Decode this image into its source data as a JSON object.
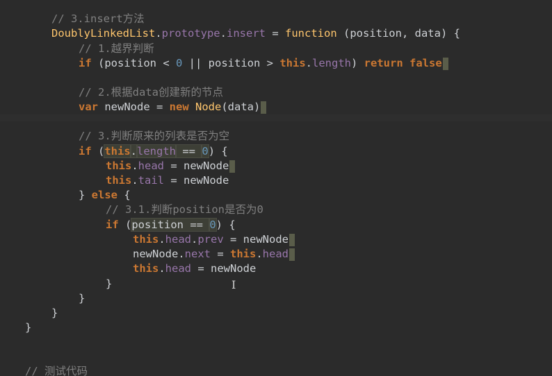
{
  "editor": {
    "lines": [
      {
        "tokens": [
          {
            "t": "// 3.insert方法",
            "c": "comment"
          }
        ]
      },
      {
        "tokens": [
          {
            "t": "DoublyLinkedList",
            "c": "type"
          },
          {
            "t": ".",
            "c": "plain"
          },
          {
            "t": "prototype",
            "c": "prop"
          },
          {
            "t": ".",
            "c": "plain"
          },
          {
            "t": "insert",
            "c": "prop"
          },
          {
            "t": " = ",
            "c": "plain"
          },
          {
            "t": "function",
            "c": "func"
          },
          {
            "t": " (position, data) {",
            "c": "plain"
          }
        ]
      },
      {
        "tokens": [
          {
            "t": "// 1.越界判断",
            "c": "comment"
          }
        ]
      },
      {
        "tokens": [
          {
            "t": "if",
            "c": "keyword"
          },
          {
            "t": " (position < ",
            "c": "plain"
          },
          {
            "t": "0",
            "c": "number"
          },
          {
            "t": " || position > ",
            "c": "plain"
          },
          {
            "t": "this",
            "c": "this"
          },
          {
            "t": ".",
            "c": "plain"
          },
          {
            "t": "length",
            "c": "prop"
          },
          {
            "t": ") ",
            "c": "plain"
          },
          {
            "t": "return",
            "c": "keyword"
          },
          {
            "t": " ",
            "c": "plain"
          },
          {
            "t": "false",
            "c": "keyword"
          }
        ]
      },
      {
        "tokens": []
      },
      {
        "tokens": [
          {
            "t": "// 2.根据data创建新的节点",
            "c": "comment"
          }
        ]
      },
      {
        "tokens": [
          {
            "t": "var",
            "c": "keyword"
          },
          {
            "t": " newNode = ",
            "c": "plain"
          },
          {
            "t": "new",
            "c": "keyword"
          },
          {
            "t": " ",
            "c": "plain"
          },
          {
            "t": "Node",
            "c": "type"
          },
          {
            "t": "(data)",
            "c": "plain"
          }
        ]
      },
      {
        "tokens": []
      },
      {
        "tokens": [
          {
            "t": "// 3.判断原来的列表是否为空",
            "c": "comment"
          }
        ]
      },
      {
        "tokens": [
          {
            "t": "if",
            "c": "keyword"
          },
          {
            "t": " (",
            "c": "plain"
          },
          {
            "t": "this",
            "c": "this",
            "hl": true
          },
          {
            "t": ".",
            "c": "plain",
            "hl": true
          },
          {
            "t": "length",
            "c": "prop",
            "hl": true
          },
          {
            "t": " == ",
            "c": "plain",
            "hl": true
          },
          {
            "t": "0",
            "c": "number",
            "hl": true
          },
          {
            "t": ") {",
            "c": "plain"
          }
        ]
      },
      {
        "tokens": [
          {
            "t": "this",
            "c": "this"
          },
          {
            "t": ".",
            "c": "plain"
          },
          {
            "t": "head",
            "c": "prop"
          },
          {
            "t": " = newNode",
            "c": "plain"
          }
        ]
      },
      {
        "tokens": [
          {
            "t": "this",
            "c": "this"
          },
          {
            "t": ".",
            "c": "plain"
          },
          {
            "t": "tail",
            "c": "prop"
          },
          {
            "t": " = newNode",
            "c": "plain"
          }
        ]
      },
      {
        "tokens": [
          {
            "t": "} ",
            "c": "plain"
          },
          {
            "t": "else",
            "c": "keyword"
          },
          {
            "t": " {",
            "c": "plain"
          }
        ]
      },
      {
        "tokens": [
          {
            "t": "// 3.1.判断position是否为0",
            "c": "comment"
          }
        ]
      },
      {
        "tokens": [
          {
            "t": "if",
            "c": "keyword"
          },
          {
            "t": " (",
            "c": "plain"
          },
          {
            "t": "position == ",
            "c": "plain",
            "hl": true
          },
          {
            "t": "0",
            "c": "number",
            "hl": true
          },
          {
            "t": ") {",
            "c": "plain"
          }
        ]
      },
      {
        "tokens": [
          {
            "t": "this",
            "c": "this"
          },
          {
            "t": ".",
            "c": "plain"
          },
          {
            "t": "head",
            "c": "prop"
          },
          {
            "t": ".",
            "c": "plain"
          },
          {
            "t": "prev",
            "c": "prop"
          },
          {
            "t": " = newNode",
            "c": "plain"
          }
        ]
      },
      {
        "tokens": [
          {
            "t": "newNode.",
            "c": "plain"
          },
          {
            "t": "next",
            "c": "prop"
          },
          {
            "t": " = ",
            "c": "plain"
          },
          {
            "t": "this",
            "c": "this"
          },
          {
            "t": ".",
            "c": "plain"
          },
          {
            "t": "head",
            "c": "prop"
          }
        ]
      },
      {
        "tokens": [
          {
            "t": "this",
            "c": "this"
          },
          {
            "t": ".",
            "c": "plain"
          },
          {
            "t": "head",
            "c": "prop"
          },
          {
            "t": " = newNode",
            "c": "plain"
          }
        ]
      },
      {
        "tokens": [
          {
            "t": "}",
            "c": "plain"
          }
        ]
      },
      {
        "tokens": [
          {
            "t": "}",
            "c": "plain"
          }
        ]
      },
      {
        "tokens": [
          {
            "t": "}",
            "c": "plain"
          }
        ]
      },
      {
        "tokens": [
          {
            "t": "}",
            "c": "plain"
          }
        ]
      },
      {
        "tokens": []
      },
      {
        "tokens": []
      },
      {
        "tokens": [
          {
            "t": "// 测试代码",
            "c": "comment"
          }
        ]
      }
    ],
    "cursor_glyph": "I"
  }
}
